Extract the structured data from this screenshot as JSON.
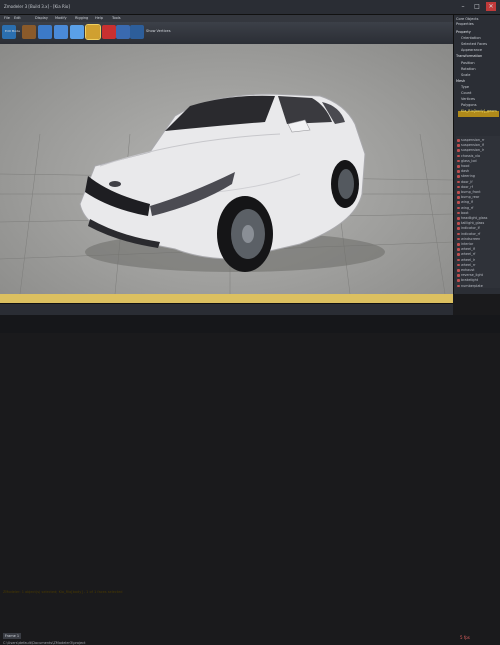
{
  "window": {
    "title": "Zmodeler 3 [Build 3.x] - [Kia Rio]",
    "controls": [
      "–",
      "□",
      "✕"
    ]
  },
  "menu": [
    "File",
    "Edit",
    "Display",
    "Modify",
    "Rigging",
    "Help",
    "Tools"
  ],
  "toolbar": {
    "buttons": [
      "Edit Mode",
      "Select",
      "Move",
      "Rotate",
      "Scale",
      "Material",
      "Texture",
      "Lights",
      "Render",
      "Show Vertices"
    ]
  },
  "right_panel": {
    "tabs": [
      "Core Objects",
      "Properties"
    ],
    "properties": [
      {
        "label": "Property",
        "style": "head"
      },
      {
        "label": "Orientation",
        "style": ""
      },
      {
        "label": "Selected Faces",
        "style": ""
      },
      {
        "label": "Appearance",
        "style": ""
      },
      {
        "label": "Transformation",
        "style": "head"
      },
      {
        "label": "Position",
        "style": ""
      },
      {
        "label": "Rotation",
        "style": ""
      },
      {
        "label": "Scale",
        "style": ""
      },
      {
        "label": "Mesh",
        "style": "head"
      },
      {
        "label": "Type",
        "style": ""
      },
      {
        "label": "Count",
        "style": ""
      },
      {
        "label": "Vertices",
        "style": ""
      },
      {
        "label": "Polygons",
        "style": ""
      },
      {
        "label": "Kia_Rio[body]_geom",
        "style": "hl"
      }
    ],
    "objects": [
      "suspension_rr",
      "suspension_lf",
      "suspension_lr",
      "chassis_vlo",
      "glass_lod",
      "hood",
      "dash",
      "steering",
      "door_lf",
      "door_rf",
      "bump_front",
      "bump_rear",
      "wing_lf",
      "wing_rf",
      "boot",
      "headlight_glass",
      "taillight_glass",
      "indicator_lf",
      "indicator_rf",
      "windscreen",
      "interior",
      "wheel_lf",
      "wheel_rf",
      "wheel_lr",
      "wheel_rr",
      "exhaust",
      "reverse_light",
      "brakelight",
      "numberplate"
    ]
  },
  "console": {
    "text": "ZModeler: 1 object(s) selected; Kia_Rio[body] - 1 of 1 faces selected"
  },
  "status": {
    "frame": "Frame 1",
    "path": "C:\\Users\\default\\Documents\\ZModeler3\\project",
    "fps": "5 fps"
  },
  "colors": {
    "accent": "#dcc060",
    "selection": "#b08a1a",
    "car_body": "#e8e8ea"
  }
}
